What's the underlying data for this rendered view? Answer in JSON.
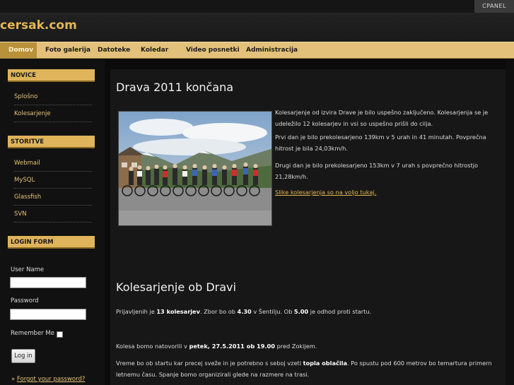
{
  "top": {
    "cpanel_label": "CPANEL"
  },
  "site": {
    "logo_text": "cersak.com"
  },
  "nav": {
    "items": [
      {
        "label": "Domov",
        "active": true
      },
      {
        "label": "Foto galerija"
      },
      {
        "label": "Datoteke"
      },
      {
        "label": "Koledar"
      },
      {
        "label": "Video posnetki"
      },
      {
        "label": "Administracija"
      }
    ]
  },
  "sidebar": {
    "novice": {
      "title": "NOVICE",
      "links": [
        "Splošno",
        "Kolesarjenje"
      ]
    },
    "storitve": {
      "title": "STORITVE",
      "links": [
        "Webmail",
        "MySQL",
        "Glassfish",
        "SVN"
      ]
    },
    "login": {
      "title": "LOGIN FORM",
      "username_label": "User Name",
      "password_label": "Password",
      "remember_label": "Remember Me",
      "button_label": "Log in",
      "forgot_bullet": "»",
      "forgot_label": "Forgot your password?"
    }
  },
  "articles": [
    {
      "title": "Drava 2011 končana",
      "paragraphs": [
        "Kolesarjenje od izvira Drave je bilo uspešno zaključeno. Kolesarjenja se je udeležilo 12 kolesarjev in vsi so uspešno prišli do cilja.",
        "Prvi dan je bilo prekolesarjeno 139km v 5 urah in 41 minutah. Povprečna hitrost je bila 24,03km/h.",
        "Drugi dan je bilo prekolesarjeno 153km v 7 urah s povprečno hitrostjo 21,28km/h."
      ],
      "link_text": "Slike kolesarjenja so na voljo tukaj."
    },
    {
      "title": "Kolesarjenje ob Dravi",
      "p1": {
        "a": "Prijavljenih je ",
        "b": "13 kolesarjev",
        "c": ". Zbor bo ob ",
        "d": "4.30",
        "e": " v Šentilju. Ob ",
        "f": "5.00",
        "g": " je odhod proti startu."
      },
      "p2": {
        "a": "Kolesa bomo natovorili v ",
        "b": "petek, 27.5.2011 ob 19.00",
        "c": " pred Zokijem."
      },
      "p3": {
        "a": "Vreme bo ob startu kar precej sveže in je potrebno s seboj vzeti ",
        "b": "topla oblačila",
        "c": ". Po spustu pod 600 metrov bo temartura primern letnemu času. Spanje bomo organizirali glede na razmere na trasi."
      }
    }
  ],
  "colors": {
    "accent": "#e2b656",
    "nav_bg": "#e3c17b",
    "box_title_bg": "#dfb45a"
  }
}
